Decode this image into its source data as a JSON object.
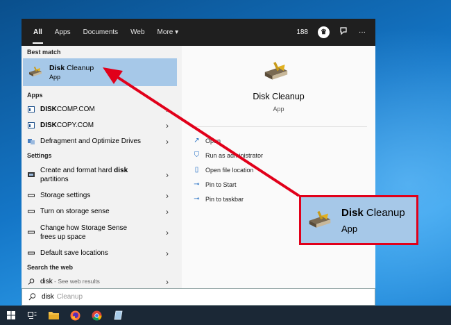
{
  "tabs": [
    "All",
    "Apps",
    "Documents",
    "Web",
    "More ▾"
  ],
  "topbar": {
    "points": "188",
    "more_glyph": "···"
  },
  "sections": {
    "best_match": "Best match",
    "apps": "Apps",
    "settings": "Settings",
    "web": "Search the web"
  },
  "best_match": {
    "title_bold": "Disk",
    "title_rest": " Cleanup",
    "subtitle": "App"
  },
  "apps": [
    {
      "bold": "DISK",
      "rest": "COMP.COM"
    },
    {
      "bold": "DISK",
      "rest": "COPY.COM"
    },
    {
      "bold": "",
      "rest": "Defragment and Optimize Drives"
    }
  ],
  "settings": [
    {
      "pre": "Create and format hard ",
      "bold": "disk",
      "post": " partitions"
    },
    {
      "pre": "Storage settings",
      "bold": "",
      "post": ""
    },
    {
      "pre": "Turn on storage sense",
      "bold": "",
      "post": ""
    },
    {
      "pre": "Change how Storage Sense frees up space",
      "bold": "",
      "post": ""
    },
    {
      "pre": "Default save locations",
      "bold": "",
      "post": ""
    }
  ],
  "web": {
    "query": "disk",
    "hint": " - See web results"
  },
  "detail": {
    "title": "Disk Cleanup",
    "subtitle": "App",
    "actions": [
      "Open",
      "Run as administrator",
      "Open file location",
      "Pin to Start",
      "Pin to taskbar"
    ]
  },
  "search": {
    "query": "disk",
    "ghost": "Cleanup"
  },
  "callout": {
    "title_bold": "Disk",
    "title_rest": " Cleanup",
    "subtitle": "App"
  },
  "colors": {
    "highlight": "#a6c8e8",
    "callout_border": "#e1001a",
    "taskbar": "#1b2836",
    "topbar": "#1f1f1f"
  },
  "icons": [
    "disk-cleanup-icon",
    "chevron-right-icon",
    "trophy-icon",
    "feedback-icon",
    "windows-start-icon",
    "task-view-icon",
    "file-explorer-icon",
    "firefox-icon",
    "chrome-icon",
    "app-icon"
  ]
}
